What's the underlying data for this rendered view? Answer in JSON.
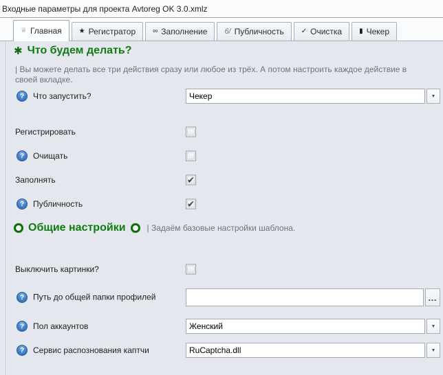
{
  "window": {
    "title": "Входные параметры для проекта Avtoreg OK 3.0.xmlz"
  },
  "tabs": [
    {
      "label": "Главная",
      "icon": "♕",
      "active": true
    },
    {
      "label": "Регистратор",
      "icon": "★",
      "active": false
    },
    {
      "label": "Заполнение",
      "icon": "∞",
      "active": false
    },
    {
      "label": "Публичность",
      "icon": "6/",
      "active": false
    },
    {
      "label": "Очистка",
      "icon": "✓",
      "active": false
    },
    {
      "label": "Чекер",
      "icon": "▮",
      "active": false
    }
  ],
  "icons": {
    "help": "?",
    "check": "✔",
    "dropdown": "▼",
    "star": "✱"
  },
  "sections": {
    "main": {
      "title": "Что будем делать?",
      "description": "| Вы можете делать все три действия сразу или любое из трёх. А потом настроить каждое действие в своей вкладке."
    },
    "general": {
      "title": "Общие настройки",
      "description": "| Задаём базовые настройки шаблона."
    }
  },
  "fields": {
    "run_what": {
      "label": "Что запустить?",
      "value": "Чекер"
    },
    "register": {
      "label": "Регистрировать",
      "checked": false
    },
    "clean": {
      "label": "Очищать",
      "checked": false
    },
    "fill": {
      "label": "Заполнять",
      "checked": true
    },
    "publicity": {
      "label": "Публичность",
      "checked": true
    },
    "disable_images": {
      "label": "Выключить картинки?",
      "checked": false
    },
    "profiles_path": {
      "label": "Путь до общей папки профилей",
      "value": "",
      "browse_label": "…"
    },
    "gender": {
      "label": "Пол аккаунтов",
      "value": "Женский"
    },
    "captcha_service": {
      "label": "Сервис распознования каптчи",
      "value": "RuCaptcha.dll"
    }
  },
  "colors": {
    "header_green": "#107c10",
    "help_icon_blue": "#3a76c4"
  }
}
